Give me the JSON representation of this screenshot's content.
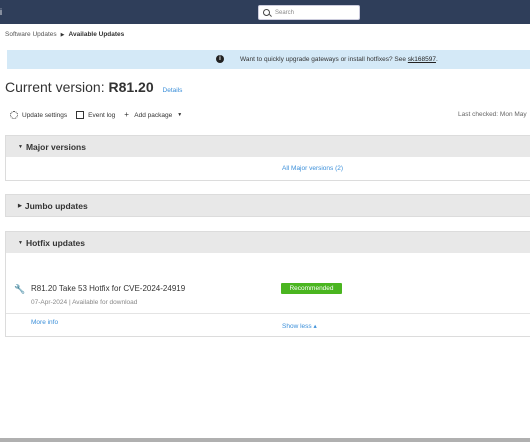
{
  "topbar": {
    "edge_glyph": "i",
    "search_placeholder": "Search"
  },
  "breadcrumb": {
    "parent": "Software Updates",
    "current": "Available Updates"
  },
  "banner": {
    "info_glyph": "i",
    "message": "Want to quickly upgrade gateways or install hotfixes? See",
    "link": "sk168597",
    "trail": "."
  },
  "header": {
    "title_prefix": "Current version:",
    "version": "R81.20",
    "details_link": "Details"
  },
  "toolbar": {
    "update_settings": "Update settings",
    "event_log": "Event log",
    "add_package": "Add package",
    "last_checked": "Last checked: Mon May"
  },
  "sections": {
    "major": {
      "title": "Major versions",
      "link": "All Major versions (2)"
    },
    "jumbo": {
      "title": "Jumbo updates"
    },
    "hotfix": {
      "title": "Hotfix updates",
      "item": {
        "name": "R81.20 Take 53 Hotfix for CVE-2024-24919",
        "badge": "Recommended",
        "date": "07-Apr-2024",
        "status": "Available for download",
        "more": "More info"
      },
      "show_less": "Show less"
    }
  },
  "colors": {
    "topbar": "#2f3e5a",
    "banner": "#d4e9f7",
    "link": "#3b8fd9",
    "badge": "#4ab520"
  }
}
